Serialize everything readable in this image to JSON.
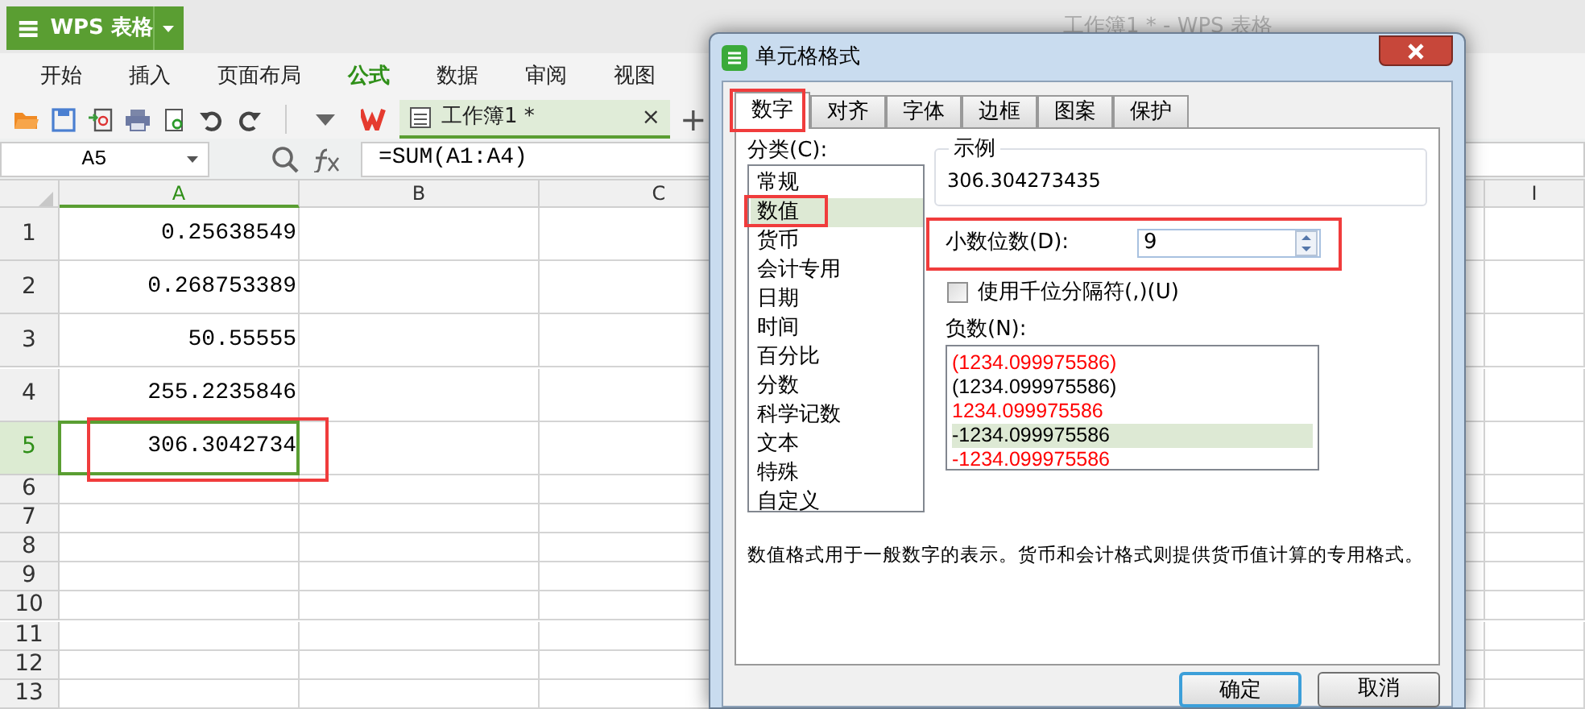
{
  "app": {
    "logo": "WPS 表格",
    "title": "工作簿1 * - WPS 表格"
  },
  "menu": [
    {
      "label": "开始",
      "selected": false
    },
    {
      "label": "插入",
      "selected": false
    },
    {
      "label": "页面布局",
      "selected": false
    },
    {
      "label": "公式",
      "selected": true
    },
    {
      "label": "数据",
      "selected": false
    },
    {
      "label": "审阅",
      "selected": false
    },
    {
      "label": "视图",
      "selected": false
    }
  ],
  "toolbar": {
    "document_tab": {
      "label": "工作簿1 *",
      "close": "×"
    },
    "new_tab": "+"
  },
  "formula_bar": {
    "name_box": "A5",
    "formula": "=SUM(A1:A4)"
  },
  "sheet": {
    "columns": [
      {
        "label": "A",
        "selected": true
      },
      {
        "label": "B",
        "selected": false
      },
      {
        "label": "C",
        "selected": false
      },
      {
        "label": "I",
        "selected": false
      }
    ],
    "rows": [
      {
        "label": "1",
        "selected": false,
        "value": "0.25638549",
        "highlight": false
      },
      {
        "label": "2",
        "selected": false,
        "value": "0.268753389",
        "highlight": false
      },
      {
        "label": "3",
        "selected": false,
        "value": "50.55555",
        "highlight": false
      },
      {
        "label": "4",
        "selected": false,
        "value": "255.2235846",
        "highlight": false
      },
      {
        "label": "5",
        "selected": true,
        "value": "306.3042734",
        "highlight": true
      },
      {
        "label": "6",
        "selected": false,
        "highlight": false
      },
      {
        "label": "7",
        "selected": false,
        "highlight": false
      },
      {
        "label": "8",
        "selected": false,
        "highlight": false
      },
      {
        "label": "9",
        "selected": false,
        "highlight": false
      },
      {
        "label": "10",
        "selected": false,
        "highlight": false
      },
      {
        "label": "11",
        "selected": false,
        "highlight": false
      },
      {
        "label": "12",
        "selected": false,
        "highlight": false
      },
      {
        "label": "13",
        "selected": false,
        "highlight": false
      }
    ]
  },
  "dialog": {
    "title": "单元格格式",
    "tabs": [
      {
        "label": "数字",
        "selected": true,
        "highlight": true
      },
      {
        "label": "对齐",
        "selected": false,
        "highlight": false
      },
      {
        "label": "字体",
        "selected": false,
        "highlight": false
      },
      {
        "label": "边框",
        "selected": false,
        "highlight": false
      },
      {
        "label": "图案",
        "selected": false,
        "highlight": false
      },
      {
        "label": "保护",
        "selected": false,
        "highlight": false
      }
    ],
    "category_label": "分类(C):",
    "categories": [
      {
        "label": "常规",
        "selected": false,
        "highlight": false
      },
      {
        "label": "数值",
        "selected": true,
        "highlight": true
      },
      {
        "label": "货币",
        "selected": false,
        "highlight": false
      },
      {
        "label": "会计专用",
        "selected": false,
        "highlight": false
      },
      {
        "label": "日期",
        "selected": false,
        "highlight": false
      },
      {
        "label": "时间",
        "selected": false,
        "highlight": false
      },
      {
        "label": "百分比",
        "selected": false,
        "highlight": false
      },
      {
        "label": "分数",
        "selected": false,
        "highlight": false
      },
      {
        "label": "科学记数",
        "selected": false,
        "highlight": false
      },
      {
        "label": "文本",
        "selected": false,
        "highlight": false
      },
      {
        "label": "特殊",
        "selected": false,
        "highlight": false
      },
      {
        "label": "自定义",
        "selected": false,
        "highlight": false
      }
    ],
    "sample": {
      "label": "示例",
      "value": "306.304273435"
    },
    "decimals": {
      "label": "小数位数(D):",
      "value": "9",
      "highlight": true
    },
    "thousands": {
      "label": "使用千位分隔符(,)(U)",
      "checked": false
    },
    "negative": {
      "label": "负数(N):",
      "items": [
        {
          "text": "(1234.099975586)",
          "color": "#ff0000",
          "selected": false
        },
        {
          "text": "(1234.099975586)",
          "color": "#000000",
          "selected": false
        },
        {
          "text": "1234.099975586",
          "color": "#ff0000",
          "selected": false
        },
        {
          "text": "-1234.099975586",
          "color": "#000000",
          "selected": true
        },
        {
          "text": "-1234.099975586",
          "color": "#ff0000",
          "selected": false
        }
      ]
    },
    "description": "数值格式用于一般数字的表示。货币和会计格式则提供货币值计算的专用格式。",
    "buttons": [
      {
        "label": "确定",
        "default": true
      },
      {
        "label": "取消",
        "default": false
      }
    ]
  }
}
